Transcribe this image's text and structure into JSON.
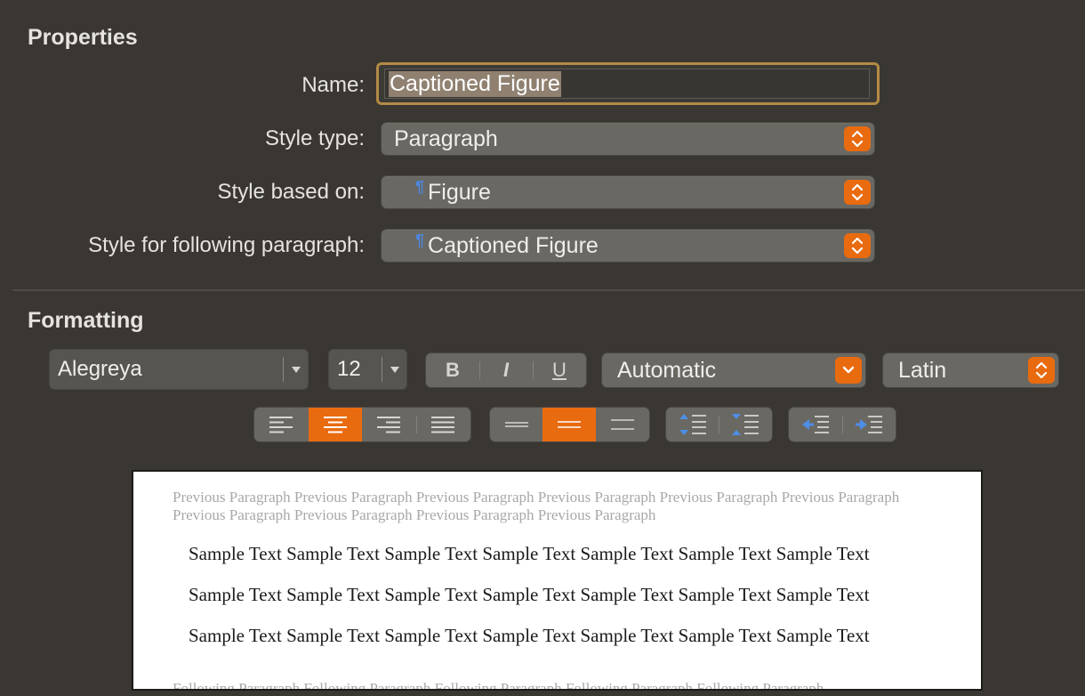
{
  "properties": {
    "title": "Properties",
    "name_label": "Name:",
    "name_value": "Captioned Figure",
    "style_type_label": "Style type:",
    "style_type_value": "Paragraph",
    "based_on_label": "Style based on:",
    "based_on_value": "Figure",
    "following_label": "Style for following paragraph:",
    "following_value": "Captioned Figure",
    "pilcrow": "¶"
  },
  "formatting": {
    "title": "Formatting",
    "font_family": "Alegreya",
    "font_size": "12",
    "bold_label": "B",
    "italic_label": "I",
    "underline_label": "U",
    "language": "Automatic",
    "script": "Latin",
    "alignment_selected": "center",
    "line_spacing_selected": "1.5",
    "accent_color": "#e96b0f"
  },
  "preview": {
    "previous": "Previous Paragraph Previous Paragraph Previous Paragraph Previous Paragraph Previous Paragraph Previous Paragraph Previous Paragraph Previous Paragraph Previous Paragraph Previous Paragraph",
    "sample_lines": [
      "Sample Text Sample Text Sample Text Sample Text Sample Text Sample Text Sample Text",
      "Sample Text Sample Text Sample Text Sample Text Sample Text Sample Text Sample Text",
      "Sample Text Sample Text Sample Text Sample Text Sample Text Sample Text Sample Text"
    ],
    "following": "Following Paragraph Following Paragraph Following Paragraph Following Paragraph Following Paragraph"
  }
}
